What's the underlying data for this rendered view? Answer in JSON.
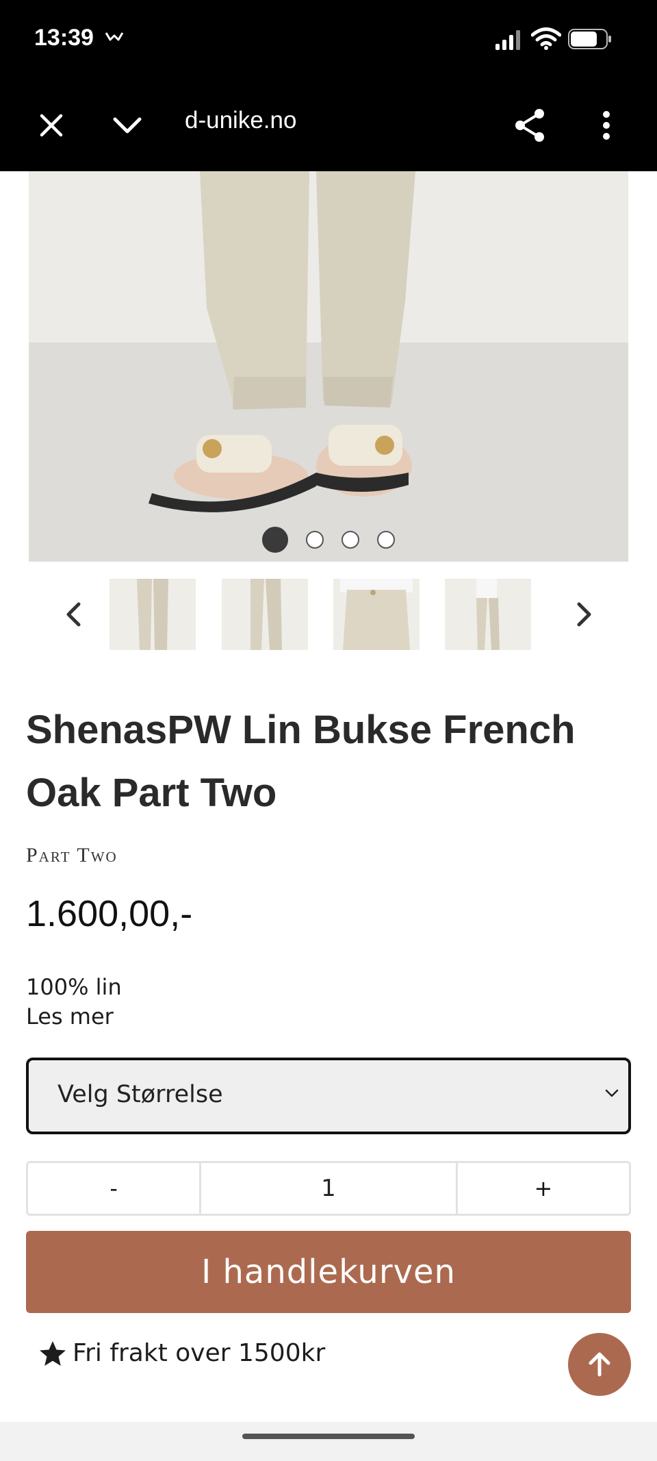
{
  "status_bar": {
    "time": "13:39",
    "icons": [
      "signal-icon",
      "wifi-icon",
      "battery-icon"
    ]
  },
  "browser": {
    "url": "d-unike.no",
    "icons": [
      "close-icon",
      "chevron-down-icon",
      "share-icon",
      "more-vertical-icon"
    ]
  },
  "gallery": {
    "image_count": 4,
    "active_index": 0,
    "thumbnail_count": 4
  },
  "product": {
    "title": "ShenasPW Lin Bukse French Oak Part Two",
    "brand": "Part Two",
    "price": "1.600,00,-",
    "description": "100% lin",
    "read_more": "Les mer"
  },
  "size_select": {
    "selected": "Velg Størrelse"
  },
  "quantity": {
    "minus": "-",
    "value": "1",
    "plus": "+"
  },
  "cart": {
    "add_label": "I handlekurven"
  },
  "shipping": {
    "text": "Fri frakt over 1500kr"
  },
  "colors": {
    "accent": "#ab6a4f",
    "bar": "#000000",
    "text": "#1d1d1d"
  }
}
